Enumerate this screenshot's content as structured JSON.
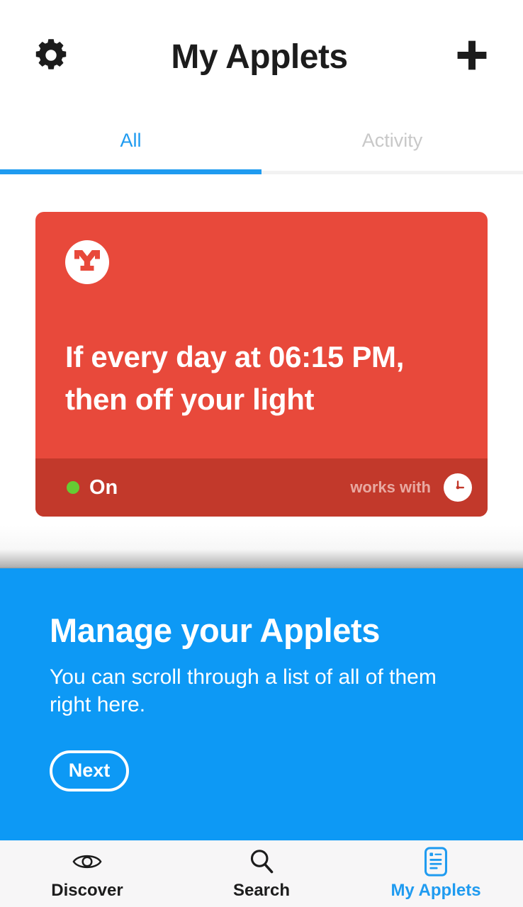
{
  "header": {
    "title": "My Applets",
    "settings_icon": "gear-icon",
    "add_icon": "plus-icon"
  },
  "tabs": [
    {
      "label": "All",
      "active": true
    },
    {
      "label": "Activity",
      "active": false
    }
  ],
  "applets": [
    {
      "service_icon": "yeelight-logo-icon",
      "title": "If every day at 06:15 PM, then off your light",
      "status": "On",
      "status_color": "#66CC33",
      "works_with_label": "works with",
      "works_with_icon": "clock-icon",
      "card_color": "#E8493B",
      "footer_color": "#C2392B"
    }
  ],
  "banner": {
    "title": "Manage your Applets",
    "body": "You can scroll through a list of all of them right here.",
    "button_label": "Next",
    "background_color": "#0D99F5"
  },
  "bottom_nav": [
    {
      "label": "Discover",
      "icon": "eye-icon",
      "active": false
    },
    {
      "label": "Search",
      "icon": "search-icon",
      "active": false
    },
    {
      "label": "My Applets",
      "icon": "document-list-icon",
      "active": true
    }
  ],
  "colors": {
    "accent_blue": "#1F9BF0",
    "banner_blue": "#0D99F5",
    "applet_red": "#E8493B",
    "applet_red_dark": "#C2392B",
    "status_green": "#66CC33",
    "nav_background": "#F7F6F7"
  }
}
